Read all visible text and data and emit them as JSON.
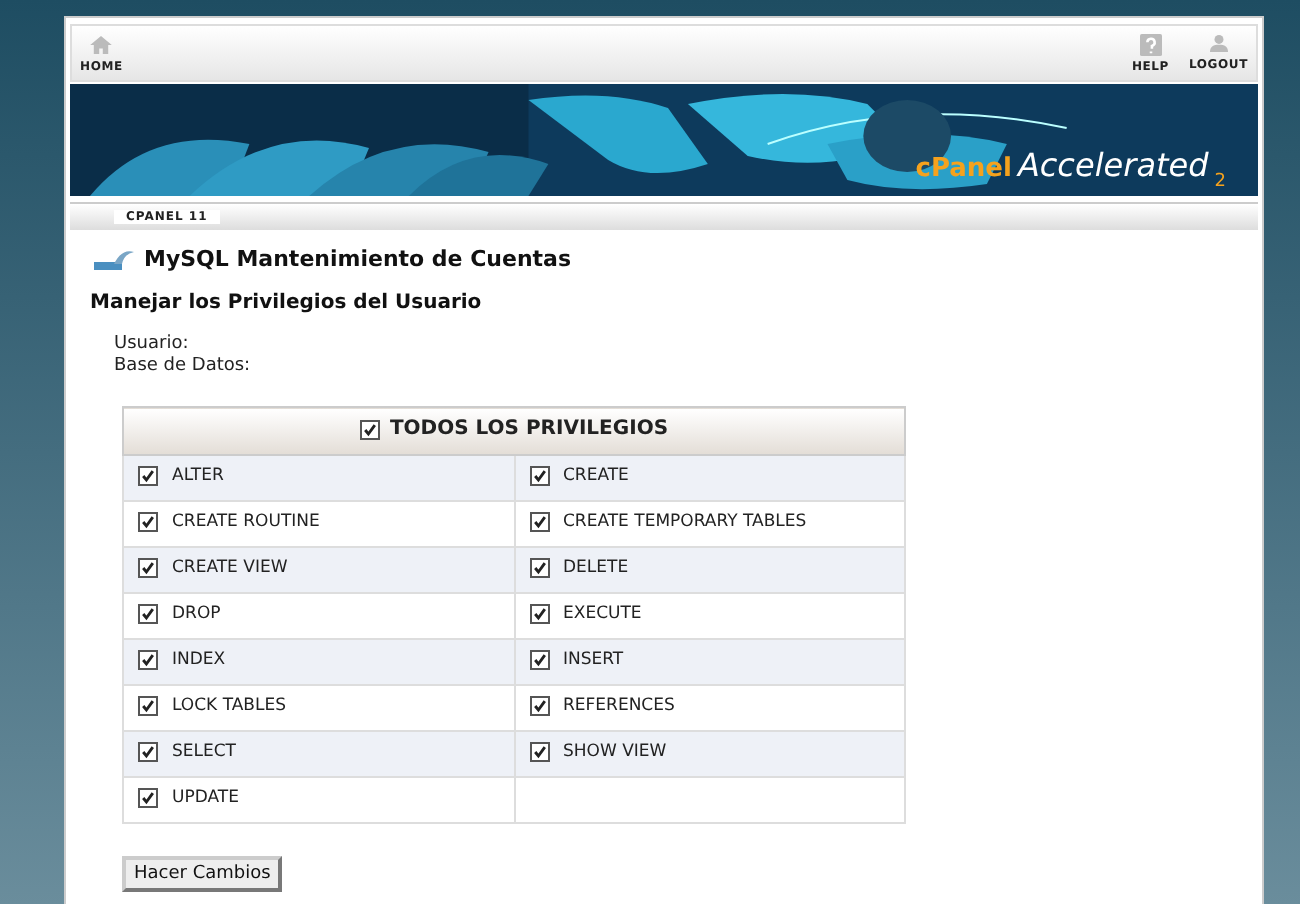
{
  "nav": {
    "left": [
      {
        "label": "HOME",
        "kind": "home"
      }
    ],
    "right": [
      {
        "label": "HELP",
        "kind": "help"
      },
      {
        "label": "LOGOUT",
        "kind": "logout"
      }
    ]
  },
  "banner": {
    "kind": "picture",
    "logo": {
      "brand": "cPanel",
      "product": "Accelerated",
      "version": "2"
    }
  },
  "breadcrumb": "CPANEL 11",
  "page_title": "MySQL Mantenimiento de Cuentas",
  "section_title": "Manejar los Privilegios del Usuario",
  "fields": [
    {
      "label": "Usuario:"
    },
    {
      "label": "Base de Datos:"
    }
  ],
  "privileges": {
    "all": {
      "label": "TODOS LOS PRIVILEGIOS",
      "checked": true
    },
    "items": [
      {
        "label": "ALTER",
        "checked": true
      },
      {
        "label": "CREATE",
        "checked": true
      },
      {
        "label": "CREATE ROUTINE",
        "checked": true
      },
      {
        "label": "CREATE TEMPORARY TABLES",
        "checked": true
      },
      {
        "label": "CREATE VIEW",
        "checked": true
      },
      {
        "label": "DELETE",
        "checked": true
      },
      {
        "label": "DROP",
        "checked": true
      },
      {
        "label": "EXECUTE",
        "checked": true
      },
      {
        "label": "INDEX",
        "checked": true
      },
      {
        "label": "INSERT",
        "checked": true
      },
      {
        "label": "LOCK TABLES",
        "checked": true
      },
      {
        "label": "REFERENCES",
        "checked": true
      },
      {
        "label": "SELECT",
        "checked": true
      },
      {
        "label": "SHOW VIEW",
        "checked": true
      },
      {
        "label": "UPDATE",
        "checked": true
      }
    ]
  },
  "submit_button": "Hacer Cambios"
}
